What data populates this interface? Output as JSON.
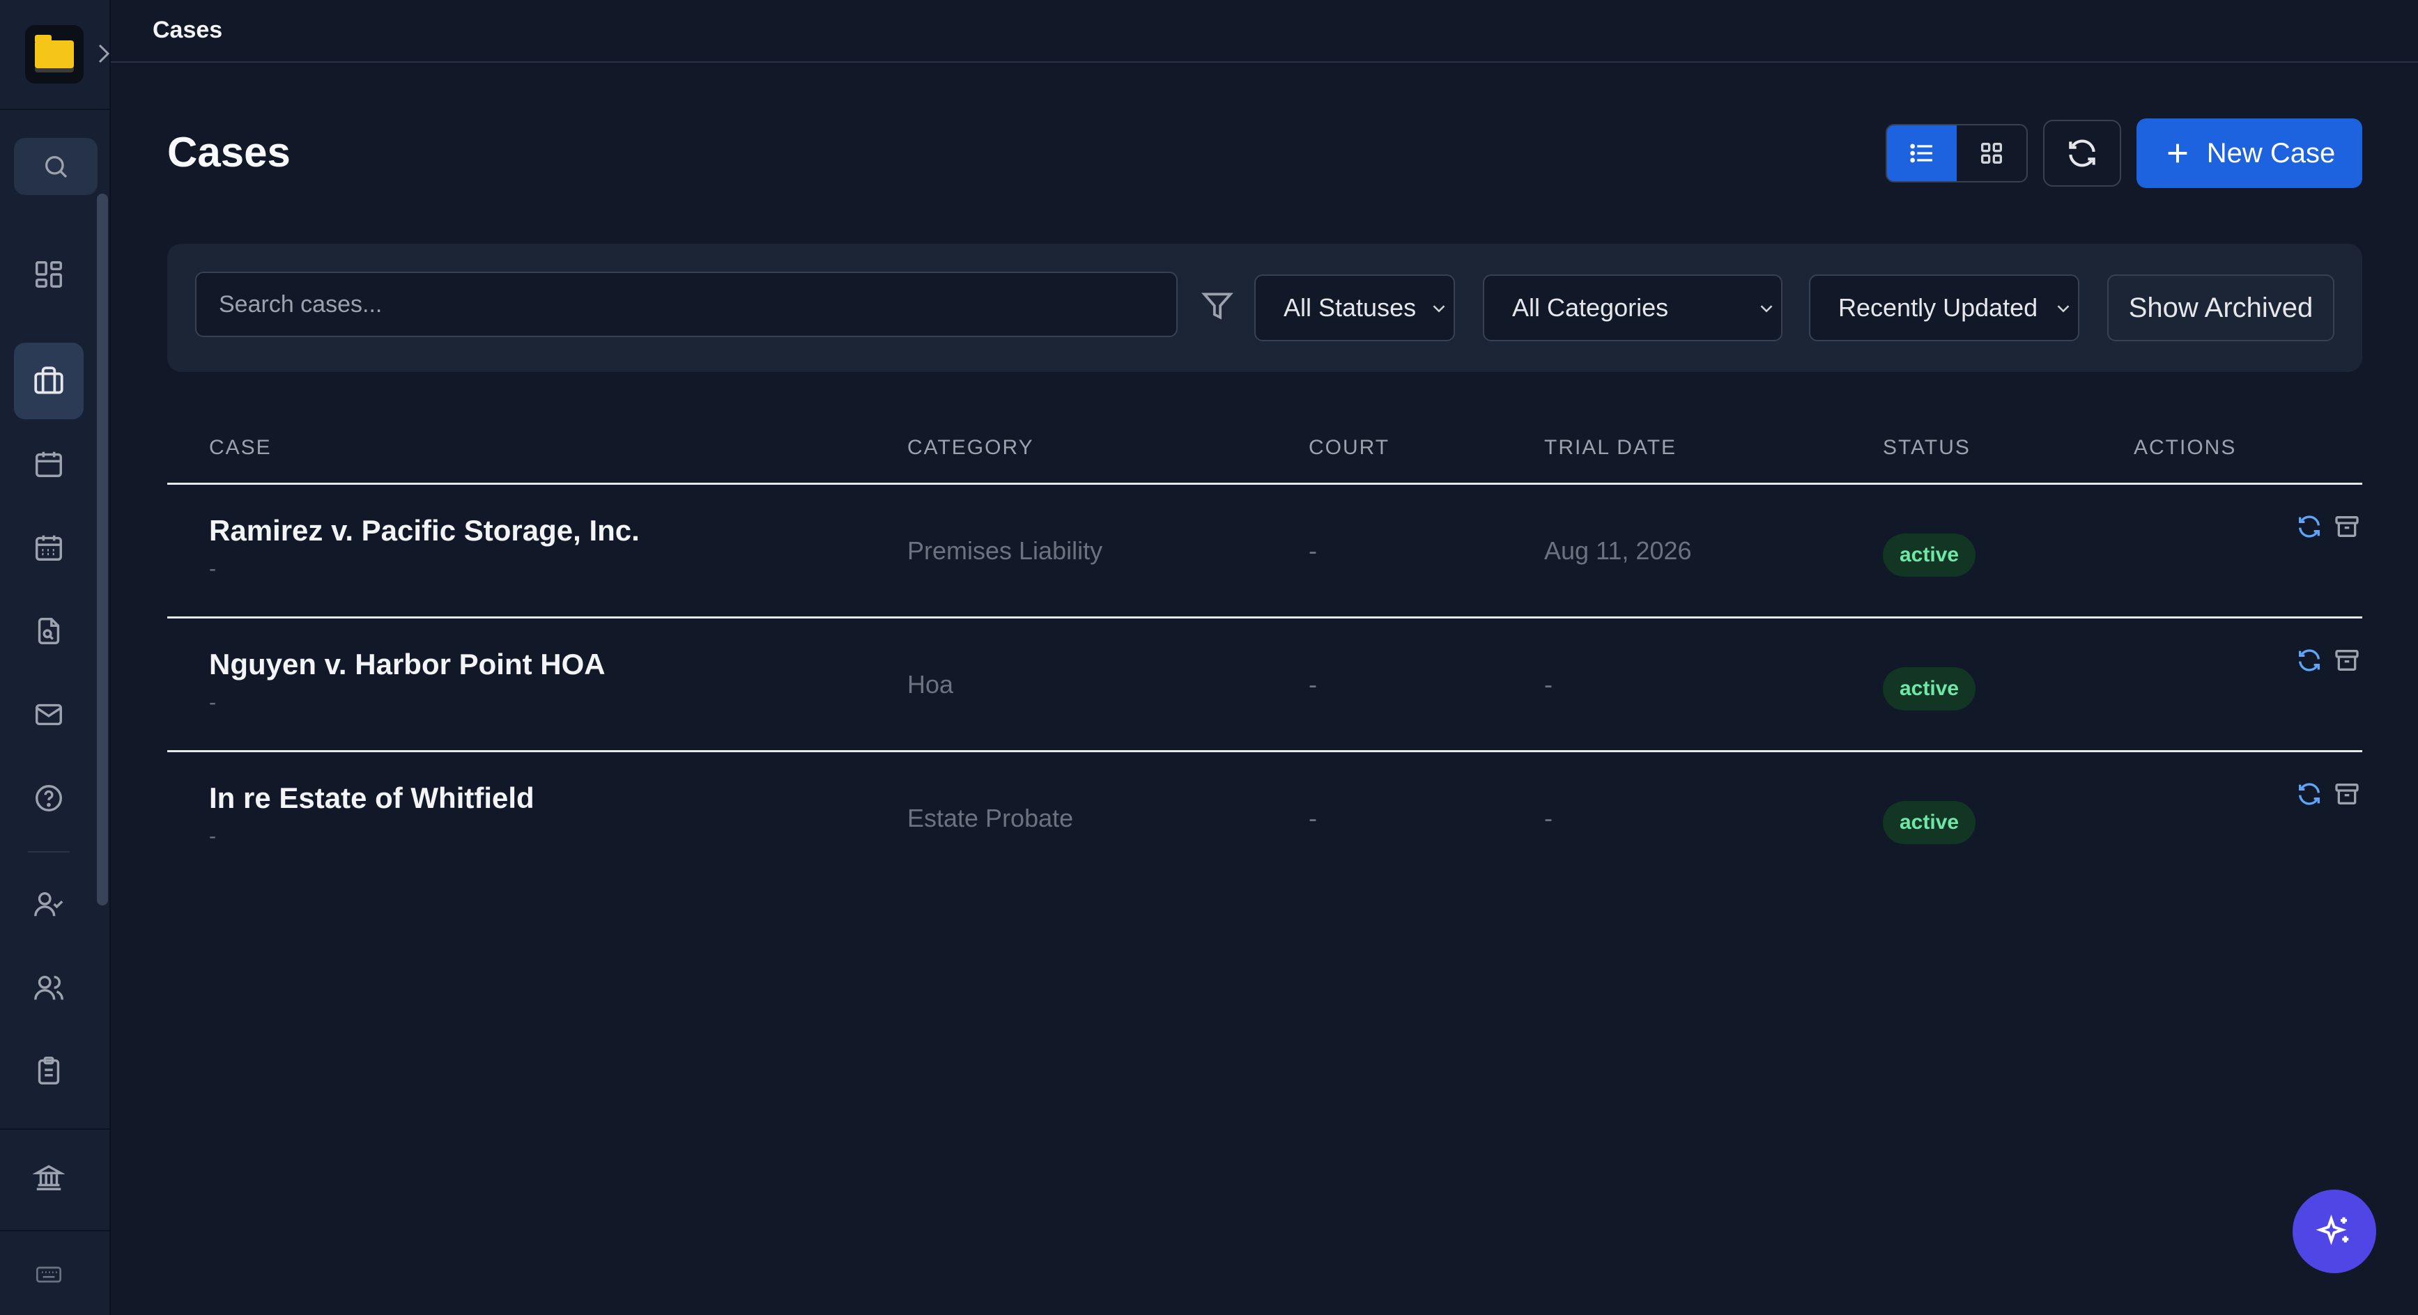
{
  "breadcrumb": "Cases",
  "page": {
    "title": "Cases",
    "new_case_label": "New Case"
  },
  "filters": {
    "search_placeholder": "Search cases...",
    "status_select": "All Statuses",
    "category_select": "All Categories",
    "sort_select": "Recently Updated",
    "archived_label": "Show Archived"
  },
  "table": {
    "headers": {
      "case": "CASE",
      "category": "CATEGORY",
      "court": "COURT",
      "trial_date": "TRIAL DATE",
      "status": "STATUS",
      "actions": "ACTIONS"
    },
    "rows": [
      {
        "case": "Ramirez v. Pacific Storage, Inc.",
        "sub": "-",
        "category": "Premises Liability",
        "court": "-",
        "trial_date": "Aug 11, 2026",
        "status": "active"
      },
      {
        "case": "Nguyen v. Harbor Point HOA",
        "sub": "-",
        "category": "Hoa",
        "court": "-",
        "trial_date": "-",
        "status": "active"
      },
      {
        "case": "In re Estate of Whitfield",
        "sub": "-",
        "category": "Estate Probate",
        "court": "-",
        "trial_date": "-",
        "status": "active"
      }
    ]
  },
  "sidebar": {
    "icons": [
      "search-icon",
      "dashboard-icon",
      "briefcase-icon",
      "calendar-icon",
      "calendar-grid-icon",
      "document-search-icon",
      "mail-icon",
      "help-icon",
      "user-check-icon",
      "users-icon",
      "clipboard-icon",
      "bank-icon",
      "keyboard-icon"
    ]
  },
  "colors": {
    "accent": "#1d63e0",
    "background": "#111827",
    "sidebar": "#172033",
    "status_active_bg": "#123524",
    "status_active_text": "#6ee7a7",
    "assistant": "#4f46e5"
  }
}
